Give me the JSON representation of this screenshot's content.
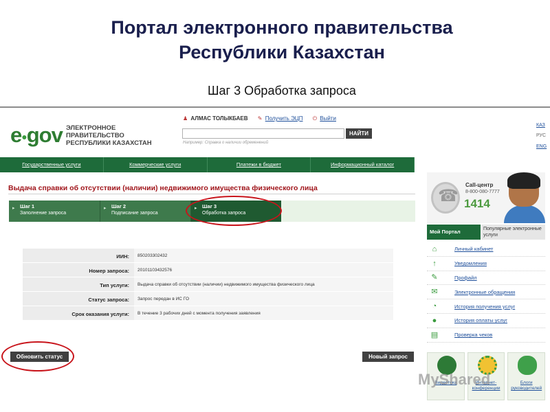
{
  "slide": {
    "title_line1": "Портал электронного правительства",
    "title_line2": "Республики Казахстан",
    "subtitle": "Шаг 3 Обработка запроса"
  },
  "header": {
    "logo_text": "e gov",
    "logo_tagline": "ЭЛЕКТРОННОЕ ПРАВИТЕЛЬСТВО РЕСПУБЛИКИ КАЗАХСТАН",
    "user_name": "АЛМАС ТОЛЫКБАЕВ",
    "get_eds_link": "Получить ЭЦП",
    "logout_link": "Выйти",
    "search_button": "НАЙТИ",
    "search_hint": "Например: Справка о наличии обременений",
    "languages": [
      "КАЗ",
      "РУС",
      "ENG"
    ]
  },
  "nav": {
    "items": [
      "Государственные услуги",
      "Коммерческие услуги",
      "Платежи в бюджет",
      "Информационный каталог"
    ]
  },
  "main": {
    "heading": "Выдача справки об отсутствии (наличии) недвижимого имущества физического лица",
    "steps": [
      {
        "title": "Шаг 1",
        "subtitle": "Заполнение запроса"
      },
      {
        "title": "Шаг 2",
        "subtitle": "Подписание запроса"
      },
      {
        "title": "Шаг 3",
        "subtitle": "Обработка запроса"
      }
    ],
    "info": [
      {
        "label": "ИИН:",
        "value": "850203302432"
      },
      {
        "label": "Номер запроса:",
        "value": "20101103432576"
      },
      {
        "label": "Тип услуги:",
        "value": "Выдача справки об отсутствии (наличии) недвижимого имущества физического лица"
      },
      {
        "label": "Статус запроса:",
        "value": "Запрос передан в ИС ГО"
      },
      {
        "label": "Срок оказания услуги:",
        "value": "В течение 3 рабочих дней с момента получения заявления"
      }
    ],
    "refresh_button": "Обновить статус",
    "new_request_button": "Новый запрос"
  },
  "sidebar": {
    "callcenter_title": "Call-центр",
    "callcenter_phone": "8-800-080-7777",
    "callcenter_short": "1414",
    "tab_active": "Мой Портал",
    "tab_inactive": "Популярные электронные услуги",
    "menu": [
      {
        "label": "Личный кабинет",
        "icon": "home-icon"
      },
      {
        "label": "Уведомления",
        "icon": "notification-icon"
      },
      {
        "label": "Профайл",
        "icon": "profile-icon"
      },
      {
        "label": "Электронные обращения",
        "icon": "appeal-icon"
      },
      {
        "label": "История получения услуг",
        "icon": "history-icon"
      },
      {
        "label": "История оплаты услуг",
        "icon": "payment-icon"
      },
      {
        "label": "Проверка чеков",
        "icon": "receipt-icon"
      }
    ],
    "tiles": [
      "Видеотека",
      "Интернет-конференции",
      "Блоги руководителей"
    ]
  },
  "watermark": "MyShared",
  "colors": {
    "nav_green": "#1e6b3a",
    "heading_red": "#a0151b",
    "link_blue": "#1d4e9a",
    "button_dark": "#404040",
    "annotation_red": "#c8141b"
  }
}
